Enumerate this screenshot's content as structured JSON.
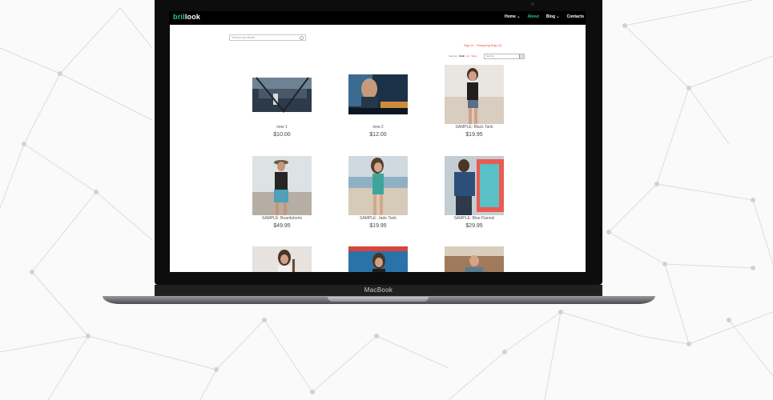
{
  "brand": {
    "logo_accent": "bril",
    "logo_rest": "look",
    "accent_color": "#2ec58a"
  },
  "device_label": "MacBook",
  "nav": [
    {
      "label": "Home ⌄"
    },
    {
      "label": "About"
    },
    {
      "label": "Blog ⌄"
    },
    {
      "label": "Contacts"
    }
  ],
  "search": {
    "placeholder": "Search products"
  },
  "account": {
    "sign_in": "Sign In",
    "separator": " · ",
    "bag": "Shopping Bag (0)"
  },
  "view_bar": {
    "label": "View as:",
    "grid": "Grid",
    "list": "List",
    "table": "Table",
    "sort": "Sort by"
  },
  "products": [
    {
      "title": "new 1",
      "price": "$10.00"
    },
    {
      "title": "new 2",
      "price": "$12.00"
    },
    {
      "title": "SAMPLE: Black Tank",
      "price": "$19.95"
    },
    {
      "title": "SAMPLE: Boardshorts",
      "price": "$49.95"
    },
    {
      "title": "SAMPLE: Jade Tank",
      "price": "$19.95"
    },
    {
      "title": "SAMPLE: Blue Flannel",
      "price": "$29.95"
    }
  ]
}
